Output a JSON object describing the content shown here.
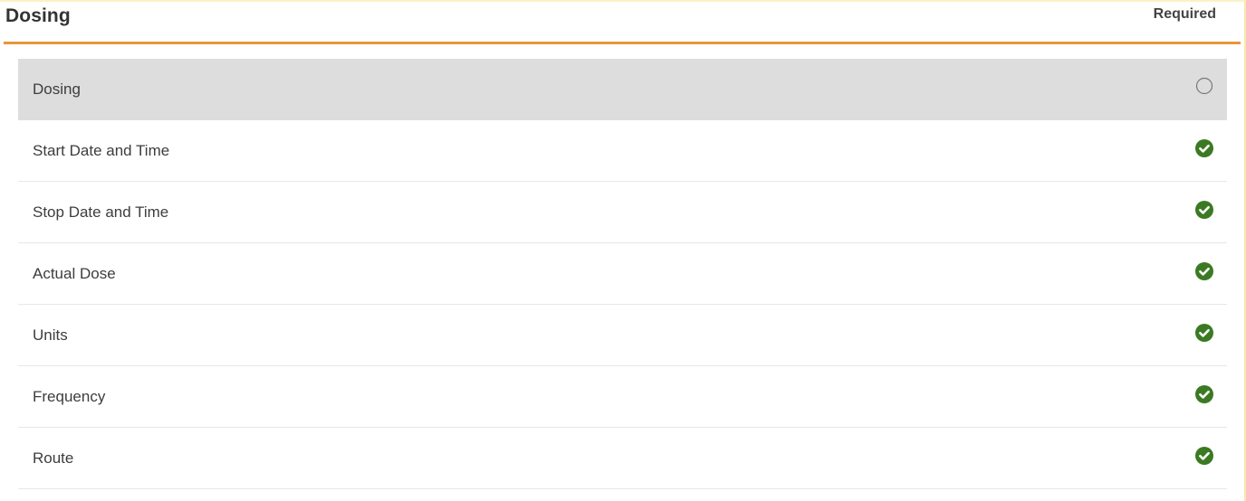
{
  "header": {
    "title": "Dosing",
    "required_label": "Required"
  },
  "colors": {
    "accent_rule": "#e8963a",
    "selected_row_bg": "#dddddd",
    "complete_icon": "#3b7a23",
    "incomplete_icon": "#777777"
  },
  "items": [
    {
      "label": "Dosing",
      "status": "incomplete",
      "icon": "empty-circle-icon",
      "selected": true
    },
    {
      "label": "Start Date and Time",
      "status": "complete",
      "icon": "check-circle-icon",
      "selected": false
    },
    {
      "label": "Stop Date and Time",
      "status": "complete",
      "icon": "check-circle-icon",
      "selected": false
    },
    {
      "label": "Actual Dose",
      "status": "complete",
      "icon": "check-circle-icon",
      "selected": false
    },
    {
      "label": "Units",
      "status": "complete",
      "icon": "check-circle-icon",
      "selected": false
    },
    {
      "label": "Frequency",
      "status": "complete",
      "icon": "check-circle-icon",
      "selected": false
    },
    {
      "label": "Route",
      "status": "complete",
      "icon": "check-circle-icon",
      "selected": false
    }
  ]
}
